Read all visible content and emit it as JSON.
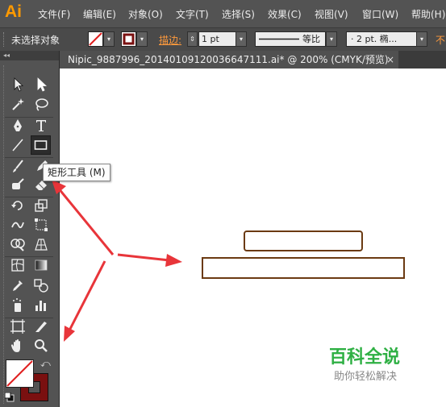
{
  "app": {
    "logo": "Ai"
  },
  "menubar": {
    "items": [
      "文件(F)",
      "编辑(E)",
      "对象(O)",
      "文字(T)",
      "选择(S)",
      "效果(C)",
      "视图(V)",
      "窗口(W)",
      "帮助(H)"
    ]
  },
  "control_bar": {
    "selection_status": "未选择对象",
    "stroke_label": "描边:",
    "stroke_weight": "1 pt",
    "profile": "等比",
    "brush": "· 2 pt. 椭...",
    "opacity_label_partial": "不",
    "colors": {
      "stroke_label": "#ff9a3c",
      "fill_none": "#ffffff",
      "stroke_color": "#7a1010"
    }
  },
  "document_tab": {
    "title": "Nipic_9887996_20140109120036647111.ai* @ 200% (CMYK/预览)",
    "close": "×"
  },
  "tools_panel": {
    "collapse": "◂◂",
    "tools": [
      "selection-tool",
      "direct-selection-tool",
      "magic-wand-tool",
      "lasso-tool",
      "pen-tool",
      "type-tool",
      "line-segment-tool",
      "rectangle-tool",
      "paintbrush-tool",
      "pencil-tool",
      "blob-brush-tool",
      "eraser-tool",
      "rotate-tool",
      "scale-tool",
      "warp-tool",
      "free-transform-tool",
      "shape-builder-tool",
      "perspective-grid-tool",
      "mesh-tool",
      "gradient-tool",
      "eyedropper-tool",
      "blend-tool",
      "symbol-sprayer-tool",
      "column-graph-tool",
      "artboard-tool",
      "slice-tool",
      "hand-tool",
      "zoom-tool"
    ],
    "active_tool": "rectangle-tool"
  },
  "tooltip": {
    "text": "矩形工具 (M)"
  },
  "canvas": {
    "shape_stroke_color": "#6b3a12",
    "annotation_color": "#e8353a"
  },
  "watermark": {
    "title": "百科全说",
    "subtitle": "助你轻松解决",
    "color": "#2fb044"
  }
}
